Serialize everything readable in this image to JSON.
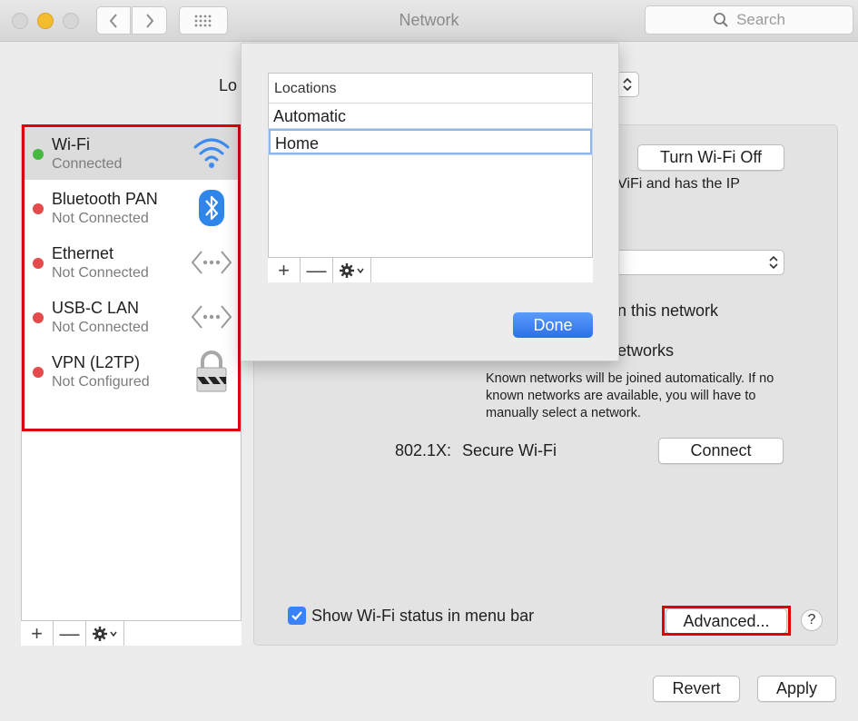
{
  "window": {
    "title": "Network"
  },
  "search": {
    "placeholder": "Search"
  },
  "location": {
    "label_visible": "Lo"
  },
  "sidebar": {
    "services": [
      {
        "name": "Wi-Fi",
        "status": "Connected",
        "status_color": "#46b83f",
        "icon": "wifi-icon"
      },
      {
        "name": "Bluetooth PAN",
        "status": "Not Connected",
        "status_color": "#e54b4b",
        "icon": "bluetooth-icon"
      },
      {
        "name": "Ethernet",
        "status": "Not Connected",
        "status_color": "#e54b4b",
        "icon": "ethernet-icon"
      },
      {
        "name": "USB-C LAN",
        "status": "Not Connected",
        "status_color": "#e54b4b",
        "icon": "ethernet-icon"
      },
      {
        "name": "VPN (L2TP)",
        "status": "Not Configured",
        "status_color": "#e54b4b",
        "icon": "lock-icon"
      }
    ],
    "toolbar": {
      "add": "+",
      "remove": "—"
    }
  },
  "sheet": {
    "header": "Locations",
    "items": [
      "Automatic",
      "Home"
    ],
    "done_label": "Done",
    "toolbar": {
      "add": "+",
      "remove": "—"
    }
  },
  "panel": {
    "turn_wifi_off_label": "Turn Wi-Fi Off",
    "status_fragment": "ViFi and has the IP",
    "ask_join_fragment": "n this network",
    "ask_new_fragment": "etworks",
    "known_networks_note": "Known networks will be joined automatically. If no known networks are available, you will have to manually select a network.",
    "dot1x_label": "802.1X:",
    "dot1x_value": "Secure Wi-Fi",
    "connect_label": "Connect",
    "show_status_label": "Show Wi-Fi status in menu bar",
    "show_status_checked": true,
    "advanced_label": "Advanced...",
    "help_label": "?"
  },
  "footer": {
    "revert_label": "Revert",
    "apply_label": "Apply"
  }
}
